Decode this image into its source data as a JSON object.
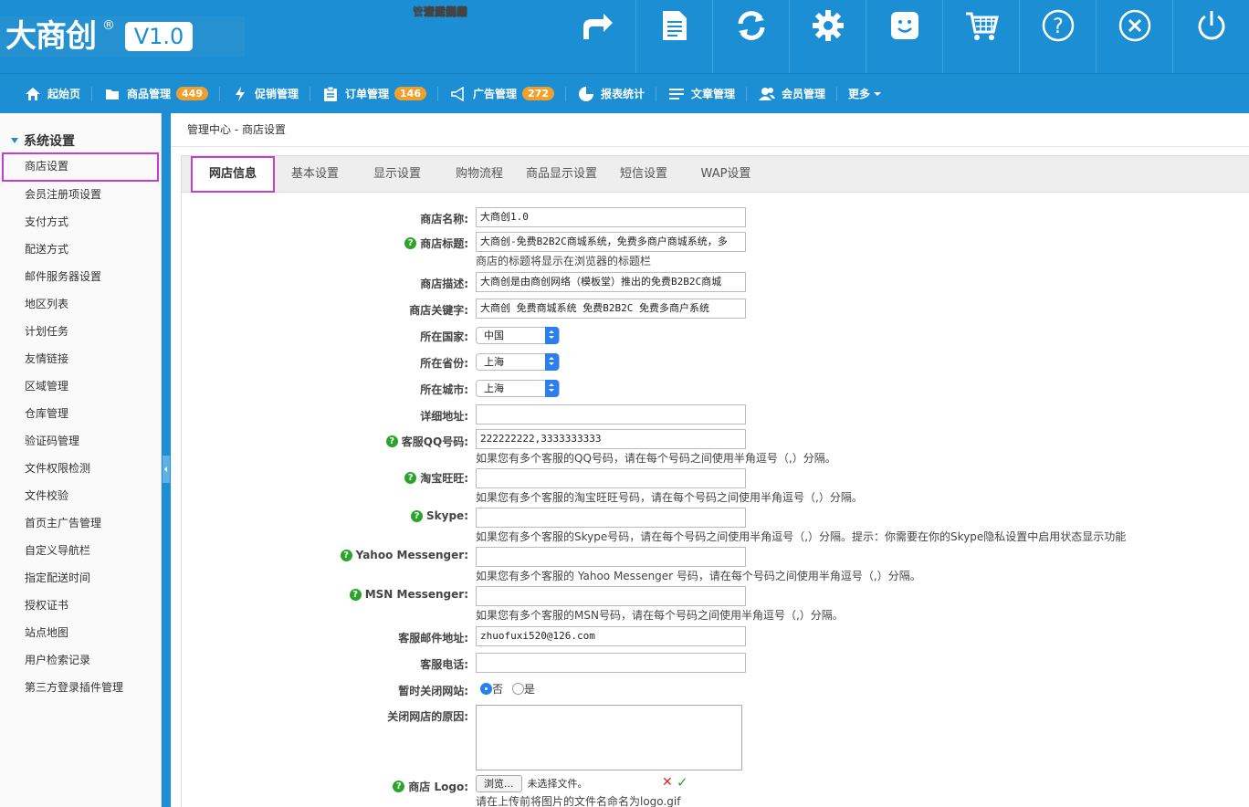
{
  "brand": {
    "name": "大商创",
    "reg": "®",
    "version": "V1.0"
  },
  "top_nav": [
    {
      "label": "开店向导",
      "icon": "share-arrow-icon"
    },
    {
      "label": "记事本",
      "icon": "notepad-icon"
    },
    {
      "label": "刷新",
      "icon": "refresh-icon"
    },
    {
      "label": "个人设置",
      "icon": "gear-icon"
    },
    {
      "label": "管理员留言",
      "icon": "smiley-chat-icon"
    },
    {
      "label": "查看网店",
      "icon": "cart-icon"
    },
    {
      "label": "帮助",
      "icon": "help-icon"
    },
    {
      "label": "清除缓存",
      "icon": "clear-icon"
    },
    {
      "label": "退出",
      "icon": "power-icon"
    }
  ],
  "sub_nav": [
    {
      "label": "起始页",
      "icon": "home-icon",
      "badge": ""
    },
    {
      "label": "商品管理",
      "icon": "folder-icon",
      "badge": "449"
    },
    {
      "label": "促销管理",
      "icon": "lightning-icon",
      "badge": ""
    },
    {
      "label": "订单管理",
      "icon": "clipboard-icon",
      "badge": "146"
    },
    {
      "label": "广告管理",
      "icon": "megaphone-icon",
      "badge": "272"
    },
    {
      "label": "报表统计",
      "icon": "pie-chart-icon",
      "badge": ""
    },
    {
      "label": "文章管理",
      "icon": "list-icon",
      "badge": ""
    },
    {
      "label": "会员管理",
      "icon": "users-icon",
      "badge": ""
    },
    {
      "label": "更多",
      "icon": "",
      "badge": ""
    }
  ],
  "sidebar": {
    "title": "系统设置",
    "items": [
      "商店设置",
      "会员注册项设置",
      "支付方式",
      "配送方式",
      "邮件服务器设置",
      "地区列表",
      "计划任务",
      "友情链接",
      "区域管理",
      "仓库管理",
      "验证码管理",
      "文件权限检测",
      "文件校验",
      "首页主广告管理",
      "自定义导航栏",
      "指定配送时间",
      "授权证书",
      "站点地图",
      "用户检索记录",
      "第三方登录插件管理"
    ]
  },
  "breadcrumb": {
    "root": "管理中心",
    "sep": " - ",
    "current": "商店设置"
  },
  "tabs": [
    "网店信息",
    "基本设置",
    "显示设置",
    "购物流程",
    "商品显示设置",
    "短信设置",
    "WAP设置"
  ],
  "form": {
    "shop_name": {
      "label": "商店名称:",
      "value": "大商创1.0"
    },
    "shop_title": {
      "label": "商店标题:",
      "value": "大商创-免费B2B2C商城系统，免费多商户商城系统，多",
      "note": "商店的标题将显示在浏览器的标题栏"
    },
    "shop_desc": {
      "label": "商店描述:",
      "value": "大商创是由商创网络（模板堂）推出的免费B2B2C商城"
    },
    "shop_keywords": {
      "label": "商店关键字:",
      "value": "大商创 免费商城系统 免费B2B2C 免费多商户系统"
    },
    "country": {
      "label": "所在国家:",
      "value": "中国"
    },
    "province": {
      "label": "所在省份:",
      "value": "上海"
    },
    "city": {
      "label": "所在城市:",
      "value": "上海"
    },
    "address": {
      "label": "详细地址:",
      "value": ""
    },
    "qq": {
      "label": "客服QQ号码:",
      "value": "222222222,3333333333",
      "note": "如果您有多个客服的QQ号码，请在每个号码之间使用半角逗号（,）分隔。"
    },
    "wangwang": {
      "label": "淘宝旺旺:",
      "value": "",
      "note": "如果您有多个客服的淘宝旺旺号码，请在每个号码之间使用半角逗号（,）分隔。"
    },
    "skype": {
      "label": "Skype:",
      "value": "",
      "note": "如果您有多个客服的Skype号码，请在每个号码之间使用半角逗号（,）分隔。提示：你需要在你的Skype隐私设置中启用状态显示功能"
    },
    "yahoo": {
      "label": "Yahoo Messenger:",
      "value": "",
      "note": "如果您有多个客服的 Yahoo Messenger 号码，请在每个号码之间使用半角逗号（,）分隔。"
    },
    "msn": {
      "label": "MSN Messenger:",
      "value": "",
      "note": "如果您有多个客服的MSN号码，请在每个号码之间使用半角逗号（,）分隔。"
    },
    "email": {
      "label": "客服邮件地址:",
      "value": "zhuofuxi520@126.com"
    },
    "phone": {
      "label": "客服电话:",
      "value": ""
    },
    "closed": {
      "label": "暂时关闭网站:",
      "opt_no": "否",
      "opt_yes": "是"
    },
    "close_reason": {
      "label": "关闭网店的原因:",
      "value": ""
    },
    "logo": {
      "label": "商店 Logo:",
      "button": "浏览...",
      "status": "未选择文件。",
      "note": "请在上传前将图片的文件名命名为logo.gif"
    }
  }
}
